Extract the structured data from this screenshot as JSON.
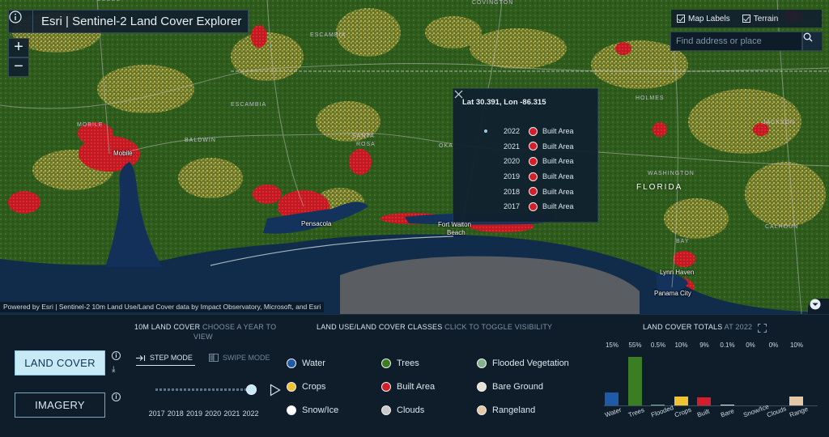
{
  "app": {
    "title": "Esri | Sentinel-2 Land Cover Explorer",
    "zoom_in": "+",
    "zoom_out": "−"
  },
  "map": {
    "toggles": [
      {
        "label": "Map Labels",
        "checked": true
      },
      {
        "label": "Terrain",
        "checked": true
      }
    ],
    "search_placeholder": "Find address or place",
    "attribution": "Powered by Esri | Sentinel-2 10m Land Use/Land Cover data by Impact Observatory, Microsoft, and Esri",
    "places": {
      "covington": "COVINGTON",
      "escambia_1": "ESCAMBIA",
      "escambia_2": "ESCAMBIA",
      "mobile_county": "MOBILE",
      "baldwin": "BALDWIN",
      "santa_rosa_1": "SANTA",
      "santa_rosa_2": "ROSA",
      "okaloosa": "OKA",
      "holmes": "HOLMES",
      "jackson": "JACKSON",
      "washington": "WASHINGTON",
      "calhoun": "CALHOUN",
      "bay": "BAY"
    },
    "cities": {
      "mobile": "Mobile",
      "pensacola": "Pensacola",
      "fort_walton_1": "Fort Walton",
      "fort_walton_2": "Beach",
      "lynn_haven": "Lynn Haven",
      "panama_city": "Panama City"
    },
    "states": {
      "florida": "FLORIDA"
    }
  },
  "popup": {
    "title": "Lat 30.391, Lon -86.315",
    "rows": [
      {
        "year": "2022",
        "class": "Built Area",
        "selected": true
      },
      {
        "year": "2021",
        "class": "Built Area",
        "selected": false
      },
      {
        "year": "2020",
        "class": "Built Area",
        "selected": false
      },
      {
        "year": "2019",
        "class": "Built Area",
        "selected": false
      },
      {
        "year": "2018",
        "class": "Built Area",
        "selected": false
      },
      {
        "year": "2017",
        "class": "Built Area",
        "selected": false
      }
    ]
  },
  "panel": {
    "land_cover_button": "LAND COVER",
    "imagery_button": "IMAGERY",
    "year_section": {
      "label": "10M LAND COVER",
      "hint": "CHOOSE A YEAR TO",
      "hint2": "VIEW"
    },
    "step_mode": "STEP MODE",
    "swipe_mode": "SWIPE MODE",
    "years": [
      "2017",
      "2018",
      "2019",
      "2020",
      "2021",
      "2022"
    ],
    "selected_year_index": 5,
    "classes_section": {
      "label": "LAND USE/LAND COVER CLASSES",
      "hint": "CLICK TO TOGGLE VISIBILITY"
    },
    "classes": [
      {
        "label": "Water",
        "color": "#1f5aa8"
      },
      {
        "label": "Trees",
        "color": "#3a7d22"
      },
      {
        "label": "Flooded Vegetation",
        "color": "#7fb38a"
      },
      {
        "label": "Crops",
        "color": "#f1c232"
      },
      {
        "label": "Built Area",
        "color": "#d41f2a"
      },
      {
        "label": "Bare Ground",
        "color": "#e6e1d6"
      },
      {
        "label": "Snow/Ice",
        "color": "#ffffff"
      },
      {
        "label": "Clouds",
        "color": "#c9c9c9"
      },
      {
        "label": "Rangeland",
        "color": "#e4c8a4"
      }
    ],
    "totals_section": {
      "label": "LAND COVER TOTALS",
      "hint": "AT 2022"
    }
  },
  "chart_data": {
    "type": "bar",
    "categories": [
      "Water",
      "Trees",
      "Flooded",
      "Crops",
      "Built",
      "Bare",
      "Snow/Ice",
      "Clouds",
      "Range"
    ],
    "values": [
      15,
      55,
      0.5,
      10,
      9,
      0.1,
      0,
      0,
      10
    ],
    "value_labels": [
      "15%",
      "55%",
      "0.5%",
      "10%",
      "9%",
      "0.1%",
      "0%",
      "0%",
      "10%"
    ],
    "colors": [
      "#1f5aa8",
      "#3a7d22",
      "#7fb38a",
      "#f1c232",
      "#d41f2a",
      "#e6e1d6",
      "#ffffff",
      "#c9c9c9",
      "#e4c8a4"
    ],
    "title": "LAND COVER TOTALS",
    "ylim": [
      0,
      55
    ]
  }
}
